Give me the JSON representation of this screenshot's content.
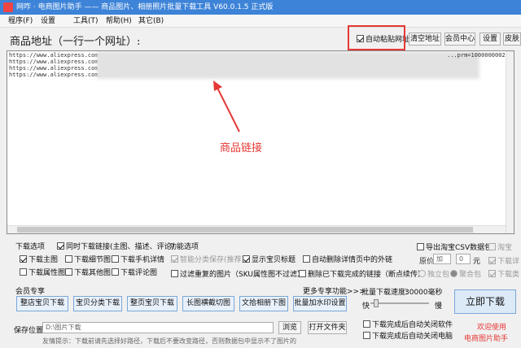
{
  "window": {
    "title": "网咋 · 电商图片助手 —— 商品图片、相册照片批量下载工具 V60.0.1.5 正式版"
  },
  "menu": {
    "items": [
      "程序(F)",
      "设置",
      "工具(T)",
      "帮助(H)",
      "其它(B)"
    ]
  },
  "address": {
    "label": "商品地址（一行一个网址）:",
    "auto_paste": "自动粘贴网址",
    "auto_paste_checked": true,
    "buttons": [
      "清空地址",
      "会员中心",
      "设置",
      "皮肤"
    ],
    "urls": [
      "https://www.aliexpress.com",
      "https://www.aliexpress.com",
      "https://www.aliexpress.com",
      "https://www.aliexpress.com/item/"
    ],
    "url_suffix_top": "...prm=10000000028"
  },
  "annotation": {
    "label": "商品链接"
  },
  "download_options": {
    "title": "下载选项",
    "sync": "同时下载链接(主图、描述、评论)",
    "items": [
      {
        "label": "下载主图",
        "checked": true
      },
      {
        "label": "下载细节图",
        "checked": false
      },
      {
        "label": "下载手机详情",
        "checked": false
      },
      {
        "label": "下载属性图",
        "checked": false
      },
      {
        "label": "下载其他图",
        "checked": false
      },
      {
        "label": "下载评论图",
        "checked": false
      }
    ]
  },
  "function_options": {
    "title": "功能选项",
    "items": [
      {
        "label": "智能分类保存(推荐)",
        "checked": true,
        "disabled": true
      },
      {
        "label": "显示宝贝标题",
        "checked": true,
        "disabled": false
      },
      {
        "label": "自动删除详情页中的外链",
        "checked": false,
        "disabled": false
      },
      {
        "label": "过滤重复的图片（SKU属性图不过滤）",
        "checked": false,
        "disabled": false
      },
      {
        "label": "删除已下载完成的链接（断点续传）",
        "checked": false,
        "disabled": false
      }
    ]
  },
  "csv": {
    "export": "导出淘宝CSV数据包",
    "price_label": "原价",
    "price_op": "加",
    "price_value": "0",
    "price_unit": "元",
    "independent": "独立包",
    "combined": "聚合包",
    "right_items": [
      "淘宝",
      "下载详",
      "下载类"
    ]
  },
  "members": {
    "title": "会员专享",
    "more": "更多专享功能>>>",
    "buttons": [
      "整店宝贝下载",
      "宝贝分类下载",
      "整页宝贝下载",
      "长图横截切图",
      "文拾相册下图",
      "批量加水印设置"
    ]
  },
  "batch_speed": {
    "label": "批量下载速度:",
    "value": "30000毫秒",
    "fast": "快",
    "slow": "慢",
    "level": 0.1,
    "after1": "下载完成后自动关闭软件",
    "after2": "下载完成后自动关闭电脑"
  },
  "save": {
    "label": "保存位置:",
    "path": "D:\\图片下载",
    "browse": "浏览",
    "open_folder": "打开文件夹",
    "tip": "友情提示：下载前请先选择好路径，下载后不要改变路径，否则数据包中显示不了图片的"
  },
  "download_now": "立即下载",
  "welcome": "欢迎使用",
  "brand": "电商图片助手",
  "colors": {
    "accent": "#3d83d8",
    "annotation": "#e53935"
  }
}
